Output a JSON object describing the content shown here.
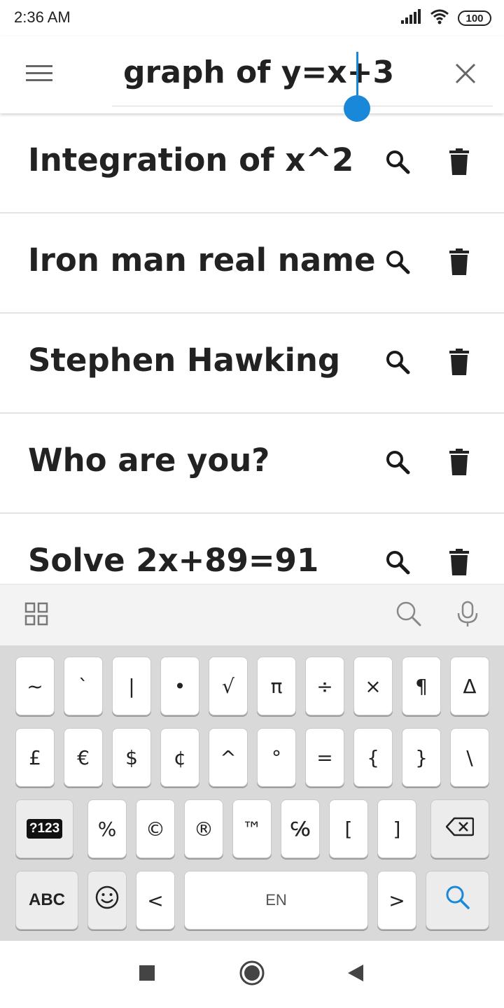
{
  "status_bar": {
    "time": "2:36 AM",
    "battery": "100",
    "icons": [
      "signal-icon",
      "wifi-icon",
      "battery-icon"
    ]
  },
  "search": {
    "query": "graph of y=x+3",
    "accent_color": "#1a88d8"
  },
  "history": [
    {
      "label": "Integration of x^2"
    },
    {
      "label": "Iron man real name"
    },
    {
      "label": "Stephen Hawking"
    },
    {
      "label": "Who are you?"
    },
    {
      "label": "Solve 2x+89=91"
    }
  ],
  "keyboard": {
    "row1": [
      "~",
      "`",
      "|",
      "•",
      "√",
      "π",
      "÷",
      "×",
      "¶",
      "Δ"
    ],
    "row2": [
      "£",
      "€",
      "$",
      "¢",
      "^",
      "°",
      "=",
      "{",
      "}",
      "\\"
    ],
    "row3": {
      "mode_key": "?123",
      "keys": [
        "%",
        "©",
        "®",
        "™",
        "℅",
        "[",
        "]"
      ]
    },
    "row4": {
      "abc_key": "ABC",
      "less_than": "<",
      "space_label": "EN",
      "greater_than": ">"
    }
  }
}
